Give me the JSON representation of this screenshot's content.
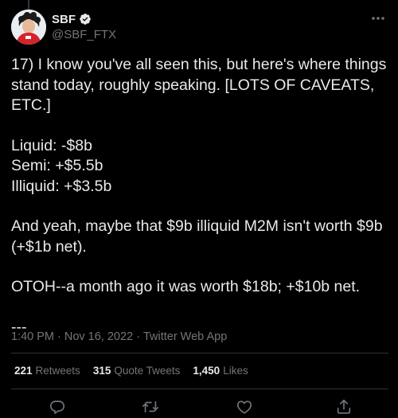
{
  "author": {
    "display_name": "SBF",
    "handle": "@SBF_FTX",
    "verified_icon": "verified-badge-icon",
    "avatar_icon": "avatar"
  },
  "tweet": {
    "lines": [
      "17) I know you've all seen this, but here's where things stand today, roughly speaking.  [LOTS OF CAVEATS, ETC.]",
      "Liquid: -$8b",
      "Semi: +$5.5b",
      "Illiquid: +$3.5b",
      "And yeah, maybe that $9b illiquid M2M isn't worth $9b (+$1b net).",
      "OTOH--a month ago it was worth $18b; +$10b net.",
      "---"
    ]
  },
  "meta": {
    "time": "1:40 PM",
    "separator": "·",
    "date": "Nov 16, 2022",
    "source": "Twitter Web App"
  },
  "stats": {
    "retweets_count": "221",
    "retweets_label": "Retweets",
    "quotes_count": "315",
    "quotes_label": "Quote Tweets",
    "likes_count": "1,450",
    "likes_label": "Likes"
  },
  "actions": {
    "icons": [
      "reply-icon",
      "retweet-icon",
      "like-icon",
      "share-icon"
    ]
  },
  "colors": {
    "background": "#000000",
    "text": "#e7e9ea",
    "secondary": "#71767b",
    "divider": "#2f3336",
    "verified": "#1d9bf0"
  }
}
